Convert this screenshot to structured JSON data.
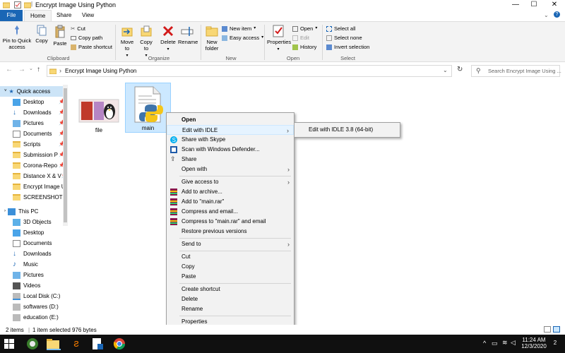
{
  "window": {
    "title": "Encrypt Image Using Python",
    "minimize": "—",
    "maximize": "☐",
    "close": "✕"
  },
  "ribbon_tabs": [
    "File",
    "Home",
    "Share",
    "View"
  ],
  "ribbon": {
    "clipboard": {
      "label": "Clipboard",
      "pin": "Pin to Quick access",
      "copy": "Copy",
      "paste": "Paste",
      "cut": "Cut",
      "copy_path": "Copy path",
      "paste_shortcut": "Paste shortcut"
    },
    "organize": {
      "label": "Organize",
      "move_to": "Move to",
      "copy_to": "Copy to",
      "delete": "Delete",
      "rename": "Rename"
    },
    "new": {
      "label": "New",
      "new_folder": "New folder",
      "new_item": "New item",
      "easy_access": "Easy access"
    },
    "open": {
      "label": "Open",
      "properties": "Properties",
      "open": "Open",
      "edit": "Edit",
      "history": "History"
    },
    "select": {
      "label": "Select",
      "select_all": "Select all",
      "select_none": "Select none",
      "invert": "Invert selection"
    }
  },
  "address": {
    "path": "Encrypt Image Using Python",
    "search_placeholder": "Search Encrypt Image Using ..."
  },
  "nav": {
    "quick_access": "Quick access",
    "items": [
      {
        "label": "Desktop",
        "pinned": true
      },
      {
        "label": "Downloads",
        "pinned": true
      },
      {
        "label": "Pictures",
        "pinned": true
      },
      {
        "label": "Documents",
        "pinned": true
      },
      {
        "label": "Scripts",
        "pinned": true
      },
      {
        "label": "Submission P",
        "pinned": true
      },
      {
        "label": "Corona-Repo",
        "pinned": true
      },
      {
        "label": "Distance X & V",
        "pinned": true
      },
      {
        "label": "Encrypt Image U",
        "pinned": false
      },
      {
        "label": "SCREENSHOTS",
        "pinned": false
      }
    ],
    "this_pc": "This PC",
    "pc_items": [
      "3D Objects",
      "Desktop",
      "Documents",
      "Downloads",
      "Music",
      "Pictures",
      "Videos",
      "Local Disk (C:)",
      "softwares (D:)",
      "education (E:)"
    ]
  },
  "files": [
    {
      "name": "file",
      "selected": false
    },
    {
      "name": "main",
      "selected": true
    }
  ],
  "context_menu": {
    "items": [
      {
        "label": "Open",
        "bold": true
      },
      {
        "label": "Edit with IDLE",
        "submenu": true,
        "highlighted": true
      },
      {
        "label": "Share with Skype",
        "icon": "skype-icon"
      },
      {
        "label": "Scan with Windows Defender...",
        "icon": "defender-icon"
      },
      {
        "label": "Share",
        "icon": "share-icon"
      },
      {
        "label": "Open with",
        "submenu": true
      },
      {
        "label": "Give access to",
        "submenu": true
      },
      {
        "label": "Add to archive...",
        "icon": "winrar-icon"
      },
      {
        "label": "Add to \"main.rar\"",
        "icon": "winrar-icon"
      },
      {
        "label": "Compress and email...",
        "icon": "winrar-icon"
      },
      {
        "label": "Compress to \"main.rar\" and email",
        "icon": "winrar-icon"
      },
      {
        "label": "Restore previous versions"
      },
      {
        "label": "Send to",
        "submenu": true
      },
      {
        "label": "Cut"
      },
      {
        "label": "Copy"
      },
      {
        "label": "Paste"
      },
      {
        "label": "Create shortcut"
      },
      {
        "label": "Delete"
      },
      {
        "label": "Rename"
      },
      {
        "label": "Properties"
      }
    ],
    "submenu_item": "Edit with IDLE 3.8 (64-bit)",
    "arrow": "›"
  },
  "status": {
    "items": "2 items",
    "selected": "1 item selected  976 bytes"
  },
  "taskbar": {
    "time": "11:24 AM",
    "date": "12/3/2020",
    "notification_count": "2"
  },
  "colors": {
    "accent": "#1a66b5",
    "selection": "#cce8ff",
    "folder": "#f8d775"
  }
}
